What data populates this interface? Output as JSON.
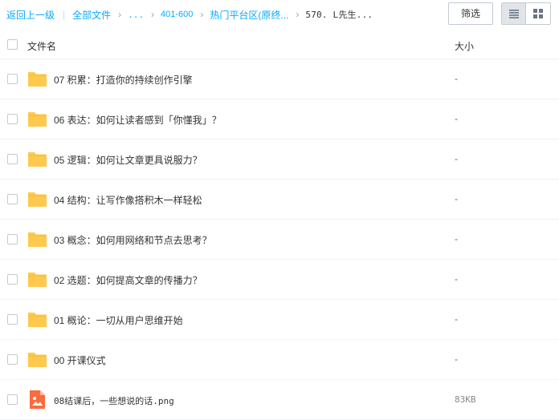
{
  "breadcrumb": {
    "back_label": "返回上一级",
    "separator": "|",
    "all_files_label": "全部文件",
    "chevron": "›",
    "items": [
      "...",
      "401-600",
      "热门平台区(原终...",
      "570. L先生..."
    ]
  },
  "toolbar": {
    "filter_label": "筛选",
    "view_list_icon": "list-view-icon",
    "view_grid_icon": "grid-view-icon",
    "active_view": "list"
  },
  "table": {
    "col_name": "文件名",
    "col_size": "大小",
    "rows": [
      {
        "type": "folder",
        "name": "07 积累：打造你的持续创作引擎",
        "size": "-"
      },
      {
        "type": "folder",
        "name": "06 表达：如何让读者感到「你懂我」？",
        "size": "-"
      },
      {
        "type": "folder",
        "name": "05 逻辑：如何让文章更具说服力？",
        "size": "-"
      },
      {
        "type": "folder",
        "name": "04 结构：让写作像搭积木一样轻松",
        "size": "-"
      },
      {
        "type": "folder",
        "name": "03 概念：如何用网络和节点去思考？",
        "size": "-"
      },
      {
        "type": "folder",
        "name": "02 选题：如何提高文章的传播力？",
        "size": "-"
      },
      {
        "type": "folder",
        "name": "01 概论：一切从用户思维开始",
        "size": "-"
      },
      {
        "type": "folder",
        "name": "00 开课仪式",
        "size": "-"
      },
      {
        "type": "image",
        "name": "08结课后，一些想说的话.png",
        "size": "83KB"
      }
    ]
  },
  "colors": {
    "link": "#09aaff",
    "folder": "#ffc94d",
    "image_file": "#fa6b3e"
  }
}
